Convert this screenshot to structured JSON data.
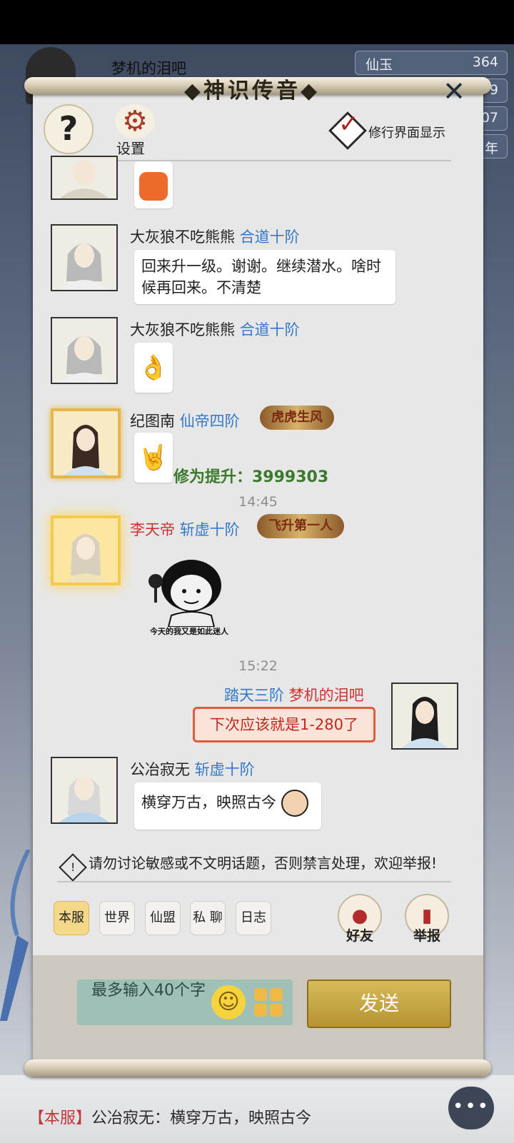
{
  "background": {
    "player_name": "梦机的泪吧",
    "resources": [
      {
        "label": "仙玉",
        "value": "364"
      },
      {
        "label": "",
        "value": "9"
      },
      {
        "label": "",
        "value": "07"
      },
      {
        "label": "",
        "value": "年"
      }
    ],
    "chat_preview": {
      "channel": "【本服】",
      "text": "公冶寂无：横穿万古，映照古今"
    }
  },
  "panel": {
    "title": "◆神识传音◆",
    "close_icon": "close-icon",
    "help_label": "?",
    "settings_label": "设置",
    "practice_display_label": "修行界面显示"
  },
  "messages": [
    {
      "name": "大灰狼不吃熊熊",
      "rank": "合道十阶",
      "text": "回来升一级。谢谢。继续潜水。啥时候再回来。不清楚"
    },
    {
      "name": "大灰狼不吃熊熊",
      "rank": "合道十阶",
      "sticker": "hand-gesture-icon"
    },
    {
      "name": "纪图南",
      "rank": "仙帝四阶",
      "badge": "虎虎生风",
      "sticker": "rock-hand-icon",
      "cultivation": "修为提升：3999303"
    },
    {
      "time": "14:45"
    },
    {
      "name": "李天帝",
      "rank": "斩虚十阶",
      "badge": "飞升第一人",
      "meme_caption": "今天的我又是如此迷人"
    },
    {
      "time": "15:22"
    },
    {
      "name": "梦机的泪吧",
      "rank": "踏天三阶",
      "text": "下次应该就是1-280了"
    },
    {
      "name": "公冶寂无",
      "rank": "斩虚十阶",
      "text": "横穿万古，映照古今"
    }
  ],
  "notice": "请勿讨论敏感或不文明话题，否则禁言处理，欢迎举报!",
  "channels": [
    "本服",
    "世界",
    "仙盟",
    "私 聊",
    "日志"
  ],
  "actions": {
    "friends": "好友",
    "report": "举报"
  },
  "input": {
    "placeholder": "最多输入40个字",
    "send_label": "发送"
  },
  "colors": {
    "rank_blue": "#3579c9",
    "name_red": "#d03131",
    "cultivation_green": "#3a7a2c",
    "send_gold": "#c9a744"
  }
}
